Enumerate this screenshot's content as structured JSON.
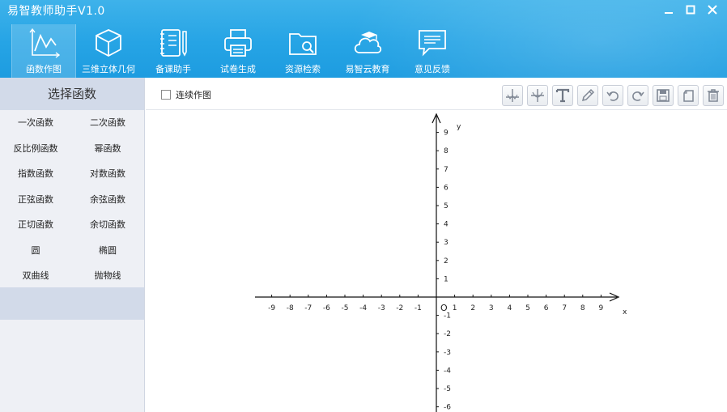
{
  "app": {
    "title": "易智教师助手V1.0"
  },
  "toolbar": {
    "items": [
      {
        "label": "函数作图",
        "icon": "function-graph-icon",
        "active": true
      },
      {
        "label": "三维立体几何",
        "icon": "cube-icon",
        "active": false
      },
      {
        "label": "备课助手",
        "icon": "notebook-icon",
        "active": false
      },
      {
        "label": "试卷生成",
        "icon": "printer-icon",
        "active": false
      },
      {
        "label": "资源检索",
        "icon": "folder-search-icon",
        "active": false
      },
      {
        "label": "易智云教育",
        "icon": "cloud-cap-icon",
        "active": false
      },
      {
        "label": "意见反馈",
        "icon": "feedback-icon",
        "active": false
      }
    ]
  },
  "sidebar": {
    "title": "选择函数",
    "functions": [
      "一次函数",
      "二次函数",
      "反比例函数",
      "幂函数",
      "指数函数",
      "对数函数",
      "正弦函数",
      "余弦函数",
      "正切函数",
      "余切函数",
      "圆",
      "椭圆",
      "双曲线",
      "抛物线"
    ]
  },
  "drawbar": {
    "continuous_label": "连续作图",
    "continuous_checked": false,
    "tools": [
      "axis-icon",
      "axis-alt-icon",
      "text-icon",
      "pencil-icon",
      "undo-icon",
      "redo-icon",
      "save-icon",
      "copy-icon",
      "delete-icon"
    ]
  },
  "graph": {
    "x_label": "x",
    "y_label": "y",
    "origin_label": "O",
    "x_ticks": [
      -9,
      -8,
      -7,
      -6,
      -5,
      -4,
      -3,
      -2,
      -1,
      1,
      2,
      3,
      4,
      5,
      6,
      7,
      8,
      9
    ],
    "y_ticks": [
      9,
      8,
      7,
      6,
      5,
      4,
      3,
      2,
      1,
      -1,
      -2,
      -3,
      -4,
      -5,
      -6
    ]
  },
  "colors": {
    "header": "#26a4e5",
    "sidebar": "#eef0f5",
    "sidebar_band": "#d2dae9"
  }
}
